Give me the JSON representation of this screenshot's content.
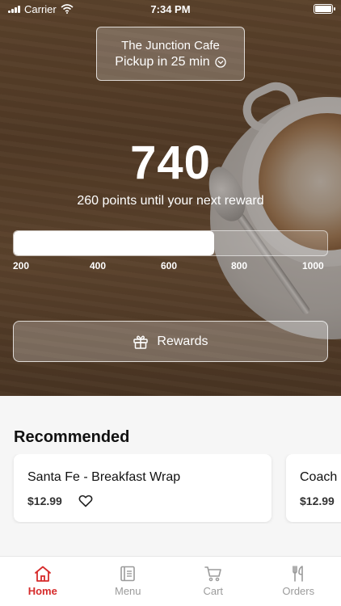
{
  "status_bar": {
    "carrier": "Carrier",
    "time": "7:34 PM"
  },
  "store": {
    "name": "The Junction Cafe",
    "pickup": "Pickup in 25 min"
  },
  "rewards": {
    "points": "740",
    "subtitle": "260 points until your next reward",
    "progress_fraction": 0.64,
    "ticks": [
      "200",
      "400",
      "600",
      "800",
      "1000"
    ],
    "button_label": "Rewards"
  },
  "recommended": {
    "title": "Recommended",
    "items": [
      {
        "name": "Santa Fe - Breakfast Wrap",
        "price": "$12.99"
      },
      {
        "name": "Coach",
        "price": "$12.99"
      }
    ]
  },
  "tabs": [
    {
      "label": "Home",
      "icon": "home-icon",
      "active": true
    },
    {
      "label": "Menu",
      "icon": "menu-icon",
      "active": false
    },
    {
      "label": "Cart",
      "icon": "cart-icon",
      "active": false
    },
    {
      "label": "Orders",
      "icon": "fork-knife-icon",
      "active": false
    }
  ],
  "colors": {
    "accent": "#d62b2b",
    "inactive": "#9b9b9b"
  }
}
